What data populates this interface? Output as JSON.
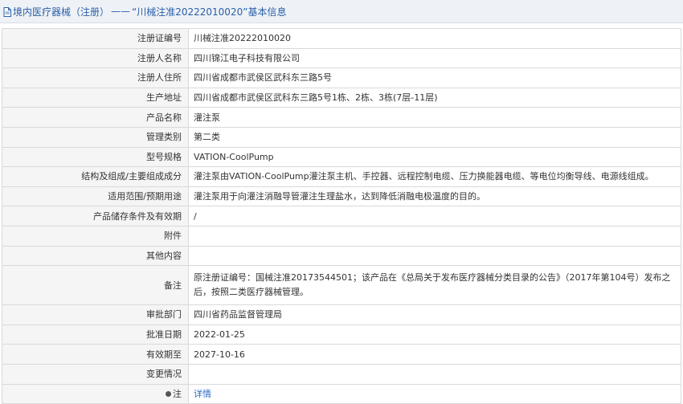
{
  "header": {
    "category": "境内医疗器械（注册）",
    "separator": "——",
    "reg_quoted": "“川械注准20222010020”",
    "suffix": "基本信息"
  },
  "rows": [
    {
      "label": "注册证编号",
      "value": "川械注准20222010020"
    },
    {
      "label": "注册人名称",
      "value": "四川锦江电子科技有限公司"
    },
    {
      "label": "注册人住所",
      "value": "四川省成都市武侯区武科东三路5号"
    },
    {
      "label": "生产地址",
      "value": "四川省成都市武侯区武科东三路5号1栋、2栋、3栋(7层-11层)"
    },
    {
      "label": "产品名称",
      "value": "灌注泵"
    },
    {
      "label": "管理类别",
      "value": "第二类"
    },
    {
      "label": "型号规格",
      "value": "VATION-CoolPump"
    },
    {
      "label": "结构及组成/主要组成成分",
      "value": "灌注泵由VATION-CoolPump灌注泵主机、手控器、远程控制电缆、压力换能器电缆、等电位均衡导线、电源线组成。"
    },
    {
      "label": "适用范围/预期用途",
      "value": "灌注泵用于向灌注消融导管灌注生理盐水，达到降低消融电极温度的目的。"
    },
    {
      "label": "产品储存条件及有效期",
      "value": "/"
    },
    {
      "label": "附件",
      "value": ""
    },
    {
      "label": "其他内容",
      "value": ""
    },
    {
      "label": "备注",
      "value": "原注册证编号：国械注准20173544501；该产品在《总局关于发布医疗器械分类目录的公告》（2017年第104号）发布之后，按照二类医疗器械管理。"
    },
    {
      "label": "审批部门",
      "value": "四川省药品监督管理局"
    },
    {
      "label": "批准日期",
      "value": "2022-01-25"
    },
    {
      "label": "有效期至",
      "value": "2027-10-16"
    },
    {
      "label": "变更情况",
      "value": ""
    }
  ],
  "note": {
    "label": "注",
    "link_text": "详情",
    "icon": "note-bullet-icon"
  },
  "colors": {
    "title": "#2a5ea8",
    "link": "#2a6bc4",
    "label_bg": "#f5f5f5",
    "border": "#d9d9d9"
  }
}
